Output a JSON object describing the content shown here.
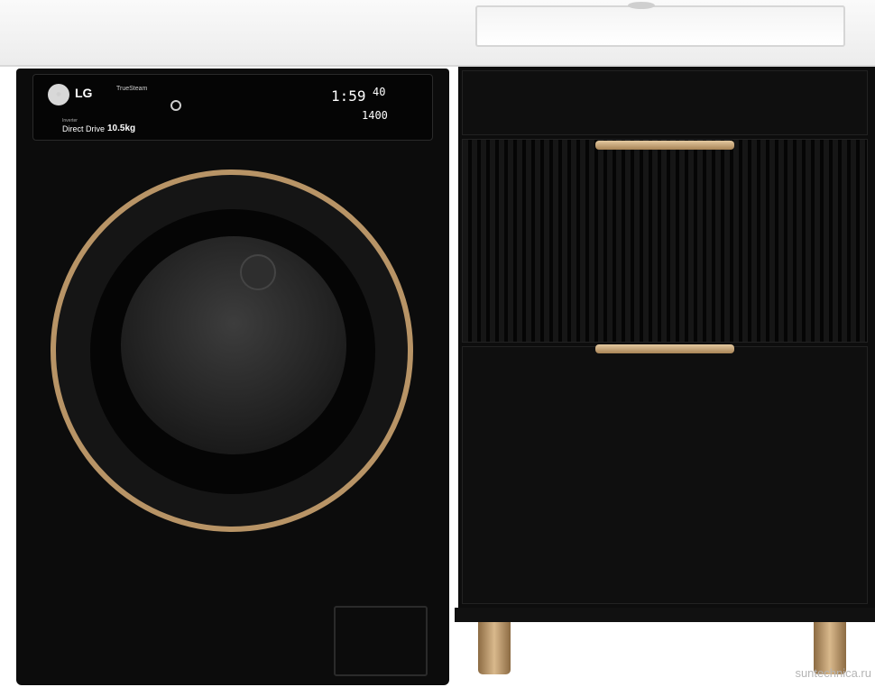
{
  "washer": {
    "brand": "LG",
    "truesteam": "TrueSteam",
    "inverter": "Inverter",
    "direct_drive": "Direct Drive",
    "capacity": "10.5kg",
    "display_time": "1:59",
    "display_temp": "40",
    "display_spin": "1400"
  },
  "watermark": "suntechnica.ru",
  "colors": {
    "accent_gold": "#b89466",
    "body_black": "#0c0c0c",
    "countertop_white": "#f4f4f4"
  }
}
